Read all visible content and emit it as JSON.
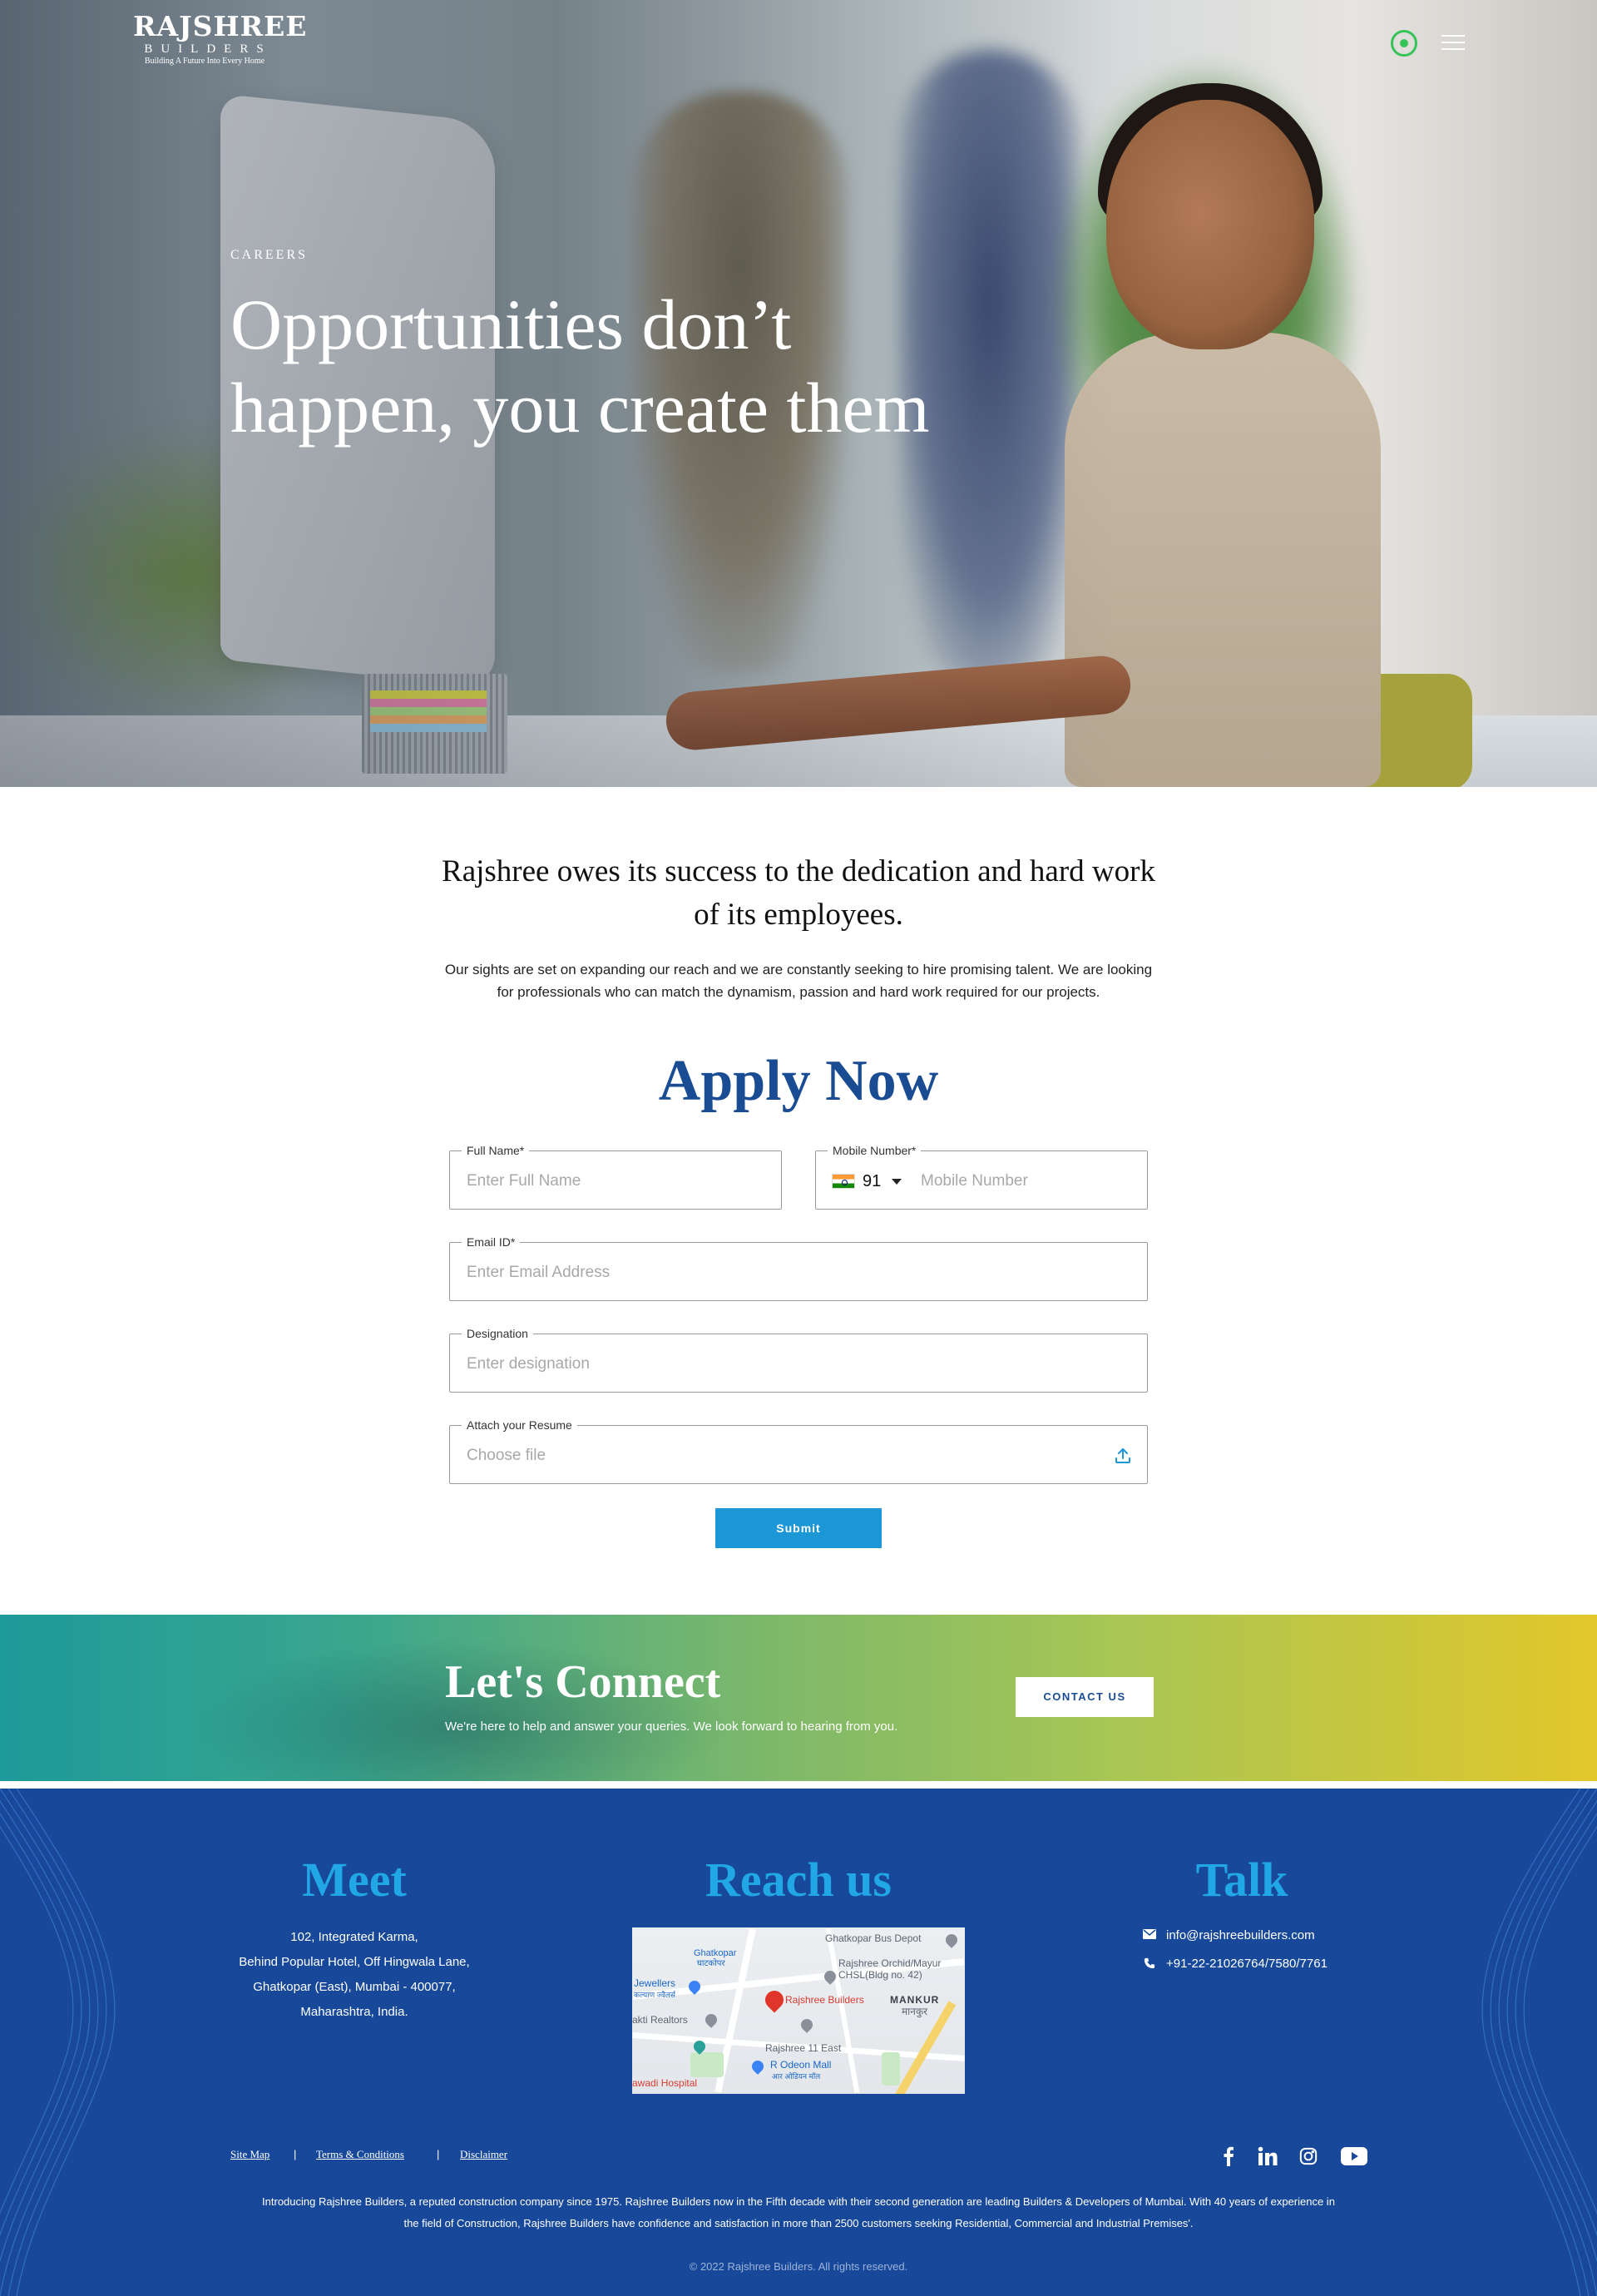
{
  "header": {
    "logo": {
      "line1": "RAJSHREE",
      "line2": "BUILDERS",
      "tagline": "Building A Future Into Every Home"
    },
    "icons": [
      "whatsapp-icon",
      "menu-icon"
    ]
  },
  "hero": {
    "kicker": "CAREERS",
    "title_line1": "Opportunities don’t",
    "title_line2": "happen, you create them"
  },
  "intro": {
    "lead_line1": "Rajshree owes its success to the dedication and hard work",
    "lead_line2": "of its employees.",
    "body_line1": "Our sights are set on expanding our reach and we are constantly seeking to hire promising talent. We are looking",
    "body_line2": "for professionals who can match the dynamism, passion and hard work required for our projects."
  },
  "apply": {
    "title": "Apply Now",
    "fields": {
      "full_name": {
        "label": "Full Name*",
        "placeholder": "Enter Full Name"
      },
      "mobile": {
        "label": "Mobile Number*",
        "country_code": "91",
        "placeholder": "Mobile Number"
      },
      "email": {
        "label": "Email ID*",
        "placeholder": "Enter Email Address"
      },
      "designation": {
        "label": "Designation",
        "placeholder": "Enter designation"
      },
      "resume": {
        "label": "Attach your Resume",
        "placeholder": "Choose file"
      }
    },
    "submit_label": "Submit"
  },
  "connect": {
    "title": "Let's Connect",
    "subtitle": "We're here to help and answer your queries. We look forward to hearing from you.",
    "button_label": "CONTACT US"
  },
  "footer": {
    "meet": {
      "title": "Meet",
      "address": [
        "102, Integrated Karma,",
        "Behind Popular Hotel, Off Hingwala Lane,",
        "Ghatkopar (East), Mumbai - 400077,",
        "Maharashtra, India."
      ]
    },
    "reach": {
      "title": "Reach us",
      "map_labels": {
        "bus_depot": "Ghatkopar Bus Depot",
        "ghatkopar_en": "Ghatkopar",
        "ghatkopar_hi": "घाटकोपर",
        "orchid_1": "Rajshree Orchid/Mayur",
        "orchid_2": "CHSL(Bldg no. 42)",
        "jewellers": "Jewellers",
        "jewellers_hi": "कल्याण ज्वैलर्स",
        "builders": "Rajshree Builders",
        "mankhurd_en": "MANKUR",
        "mankhurd_hi": "मानकुर",
        "realtors": "akti Realtors",
        "east": "Rajshree 11 East",
        "mall": "R Odeon Mall",
        "mall_hi": "आर ओडियन मॉल",
        "hospital": "awadi Hospital"
      }
    },
    "talk": {
      "title": "Talk",
      "email": "info@rajshreebuilders.com",
      "phone": "+91-22-21026764/7580/7761"
    },
    "links": [
      "Site Map",
      "Terms & Conditions",
      "Disclaimer"
    ],
    "separator": "|",
    "social": [
      "facebook-icon",
      "linkedin-icon",
      "instagram-icon",
      "youtube-icon"
    ],
    "about_line1": "Introducing Rajshree Builders, a reputed construction company since 1975. Rajshree Builders now in the Fifth decade with their second generation are leading Builders & Developers of Mumbai. With 40 years of experience in",
    "about_line2": "the field of Construction, Rajshree Builders have confidence and satisfaction in more than 2500 customers seeking Residential, Commercial and Industrial Premises'.",
    "copyright": "© 2022 Rajshree Builders. All rights reserved."
  },
  "colors": {
    "brand_blue": "#17489a",
    "heading_blue": "#1a4c93",
    "accent_cyan": "#21a6e6",
    "submit_blue": "#1a97d4"
  }
}
